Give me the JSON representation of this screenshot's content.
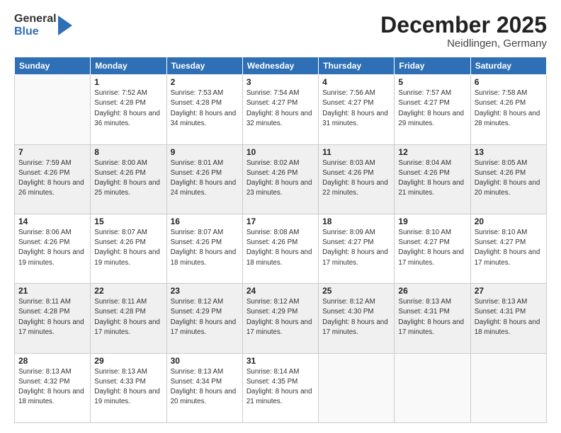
{
  "logo": {
    "general": "General",
    "blue": "Blue"
  },
  "header": {
    "month": "December 2025",
    "location": "Neidlingen, Germany"
  },
  "days_of_week": [
    "Sunday",
    "Monday",
    "Tuesday",
    "Wednesday",
    "Thursday",
    "Friday",
    "Saturday"
  ],
  "weeks": [
    [
      {
        "num": "",
        "sunrise": "",
        "sunset": "",
        "daylight": ""
      },
      {
        "num": "1",
        "sunrise": "Sunrise: 7:52 AM",
        "sunset": "Sunset: 4:28 PM",
        "daylight": "Daylight: 8 hours and 36 minutes."
      },
      {
        "num": "2",
        "sunrise": "Sunrise: 7:53 AM",
        "sunset": "Sunset: 4:28 PM",
        "daylight": "Daylight: 8 hours and 34 minutes."
      },
      {
        "num": "3",
        "sunrise": "Sunrise: 7:54 AM",
        "sunset": "Sunset: 4:27 PM",
        "daylight": "Daylight: 8 hours and 32 minutes."
      },
      {
        "num": "4",
        "sunrise": "Sunrise: 7:56 AM",
        "sunset": "Sunset: 4:27 PM",
        "daylight": "Daylight: 8 hours and 31 minutes."
      },
      {
        "num": "5",
        "sunrise": "Sunrise: 7:57 AM",
        "sunset": "Sunset: 4:27 PM",
        "daylight": "Daylight: 8 hours and 29 minutes."
      },
      {
        "num": "6",
        "sunrise": "Sunrise: 7:58 AM",
        "sunset": "Sunset: 4:26 PM",
        "daylight": "Daylight: 8 hours and 28 minutes."
      }
    ],
    [
      {
        "num": "7",
        "sunrise": "Sunrise: 7:59 AM",
        "sunset": "Sunset: 4:26 PM",
        "daylight": "Daylight: 8 hours and 26 minutes."
      },
      {
        "num": "8",
        "sunrise": "Sunrise: 8:00 AM",
        "sunset": "Sunset: 4:26 PM",
        "daylight": "Daylight: 8 hours and 25 minutes."
      },
      {
        "num": "9",
        "sunrise": "Sunrise: 8:01 AM",
        "sunset": "Sunset: 4:26 PM",
        "daylight": "Daylight: 8 hours and 24 minutes."
      },
      {
        "num": "10",
        "sunrise": "Sunrise: 8:02 AM",
        "sunset": "Sunset: 4:26 PM",
        "daylight": "Daylight: 8 hours and 23 minutes."
      },
      {
        "num": "11",
        "sunrise": "Sunrise: 8:03 AM",
        "sunset": "Sunset: 4:26 PM",
        "daylight": "Daylight: 8 hours and 22 minutes."
      },
      {
        "num": "12",
        "sunrise": "Sunrise: 8:04 AM",
        "sunset": "Sunset: 4:26 PM",
        "daylight": "Daylight: 8 hours and 21 minutes."
      },
      {
        "num": "13",
        "sunrise": "Sunrise: 8:05 AM",
        "sunset": "Sunset: 4:26 PM",
        "daylight": "Daylight: 8 hours and 20 minutes."
      }
    ],
    [
      {
        "num": "14",
        "sunrise": "Sunrise: 8:06 AM",
        "sunset": "Sunset: 4:26 PM",
        "daylight": "Daylight: 8 hours and 19 minutes."
      },
      {
        "num": "15",
        "sunrise": "Sunrise: 8:07 AM",
        "sunset": "Sunset: 4:26 PM",
        "daylight": "Daylight: 8 hours and 19 minutes."
      },
      {
        "num": "16",
        "sunrise": "Sunrise: 8:07 AM",
        "sunset": "Sunset: 4:26 PM",
        "daylight": "Daylight: 8 hours and 18 minutes."
      },
      {
        "num": "17",
        "sunrise": "Sunrise: 8:08 AM",
        "sunset": "Sunset: 4:26 PM",
        "daylight": "Daylight: 8 hours and 18 minutes."
      },
      {
        "num": "18",
        "sunrise": "Sunrise: 8:09 AM",
        "sunset": "Sunset: 4:27 PM",
        "daylight": "Daylight: 8 hours and 17 minutes."
      },
      {
        "num": "19",
        "sunrise": "Sunrise: 8:10 AM",
        "sunset": "Sunset: 4:27 PM",
        "daylight": "Daylight: 8 hours and 17 minutes."
      },
      {
        "num": "20",
        "sunrise": "Sunrise: 8:10 AM",
        "sunset": "Sunset: 4:27 PM",
        "daylight": "Daylight: 8 hours and 17 minutes."
      }
    ],
    [
      {
        "num": "21",
        "sunrise": "Sunrise: 8:11 AM",
        "sunset": "Sunset: 4:28 PM",
        "daylight": "Daylight: 8 hours and 17 minutes."
      },
      {
        "num": "22",
        "sunrise": "Sunrise: 8:11 AM",
        "sunset": "Sunset: 4:28 PM",
        "daylight": "Daylight: 8 hours and 17 minutes."
      },
      {
        "num": "23",
        "sunrise": "Sunrise: 8:12 AM",
        "sunset": "Sunset: 4:29 PM",
        "daylight": "Daylight: 8 hours and 17 minutes."
      },
      {
        "num": "24",
        "sunrise": "Sunrise: 8:12 AM",
        "sunset": "Sunset: 4:29 PM",
        "daylight": "Daylight: 8 hours and 17 minutes."
      },
      {
        "num": "25",
        "sunrise": "Sunrise: 8:12 AM",
        "sunset": "Sunset: 4:30 PM",
        "daylight": "Daylight: 8 hours and 17 minutes."
      },
      {
        "num": "26",
        "sunrise": "Sunrise: 8:13 AM",
        "sunset": "Sunset: 4:31 PM",
        "daylight": "Daylight: 8 hours and 17 minutes."
      },
      {
        "num": "27",
        "sunrise": "Sunrise: 8:13 AM",
        "sunset": "Sunset: 4:31 PM",
        "daylight": "Daylight: 8 hours and 18 minutes."
      }
    ],
    [
      {
        "num": "28",
        "sunrise": "Sunrise: 8:13 AM",
        "sunset": "Sunset: 4:32 PM",
        "daylight": "Daylight: 8 hours and 18 minutes."
      },
      {
        "num": "29",
        "sunrise": "Sunrise: 8:13 AM",
        "sunset": "Sunset: 4:33 PM",
        "daylight": "Daylight: 8 hours and 19 minutes."
      },
      {
        "num": "30",
        "sunrise": "Sunrise: 8:13 AM",
        "sunset": "Sunset: 4:34 PM",
        "daylight": "Daylight: 8 hours and 20 minutes."
      },
      {
        "num": "31",
        "sunrise": "Sunrise: 8:14 AM",
        "sunset": "Sunset: 4:35 PM",
        "daylight": "Daylight: 8 hours and 21 minutes."
      },
      {
        "num": "",
        "sunrise": "",
        "sunset": "",
        "daylight": ""
      },
      {
        "num": "",
        "sunrise": "",
        "sunset": "",
        "daylight": ""
      },
      {
        "num": "",
        "sunrise": "",
        "sunset": "",
        "daylight": ""
      }
    ]
  ]
}
